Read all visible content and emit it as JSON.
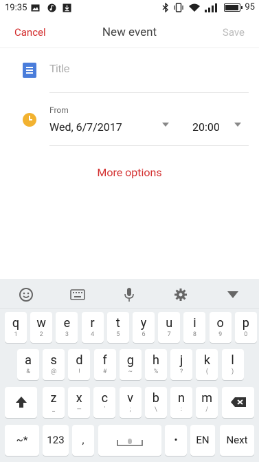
{
  "status_bar": {
    "time": "19:35",
    "battery_percent": "95"
  },
  "header": {
    "cancel": "Cancel",
    "title": "New event",
    "save": "Save"
  },
  "title_field": {
    "placeholder": "Title",
    "value": ""
  },
  "from": {
    "label": "From",
    "date": "Wed, 6/7/2017",
    "time": "20:00"
  },
  "more_options": "More options",
  "keyboard": {
    "toolbar": [
      "emoji-icon",
      "keyboard-icon",
      "microphone-icon",
      "gear-icon",
      "collapse-icon"
    ],
    "row1": [
      {
        "k": "q",
        "s": "1"
      },
      {
        "k": "w",
        "s": "2"
      },
      {
        "k": "e",
        "s": "3"
      },
      {
        "k": "r",
        "s": "4"
      },
      {
        "k": "t",
        "s": "5"
      },
      {
        "k": "y",
        "s": "6"
      },
      {
        "k": "u",
        "s": "7"
      },
      {
        "k": "i",
        "s": "8"
      },
      {
        "k": "o",
        "s": "9"
      },
      {
        "k": "p",
        "s": "0"
      }
    ],
    "row2": [
      {
        "k": "a",
        "s": "&"
      },
      {
        "k": "s",
        "s": "@"
      },
      {
        "k": "d",
        "s": "!"
      },
      {
        "k": "f",
        "s": "#"
      },
      {
        "k": "g",
        "s": "~"
      },
      {
        "k": "h",
        "s": "%"
      },
      {
        "k": "j",
        "s": "?"
      },
      {
        "k": "k",
        "s": "("
      },
      {
        "k": "l",
        "s": ")"
      }
    ],
    "row3": [
      {
        "k": "z",
        "s": "_"
      },
      {
        "k": "x",
        "s": "—"
      },
      {
        "k": "c",
        "s": "'"
      },
      {
        "k": "v",
        "s": ";"
      },
      {
        "k": "b",
        "s": "\\"
      },
      {
        "k": "n",
        "s": ":"
      },
      {
        "k": "m",
        "s": "/"
      }
    ],
    "row4": {
      "symbols": "~*",
      "numbers": "123",
      "comma": ",",
      "period": "•",
      "lang": "EN",
      "next": "Next"
    }
  }
}
